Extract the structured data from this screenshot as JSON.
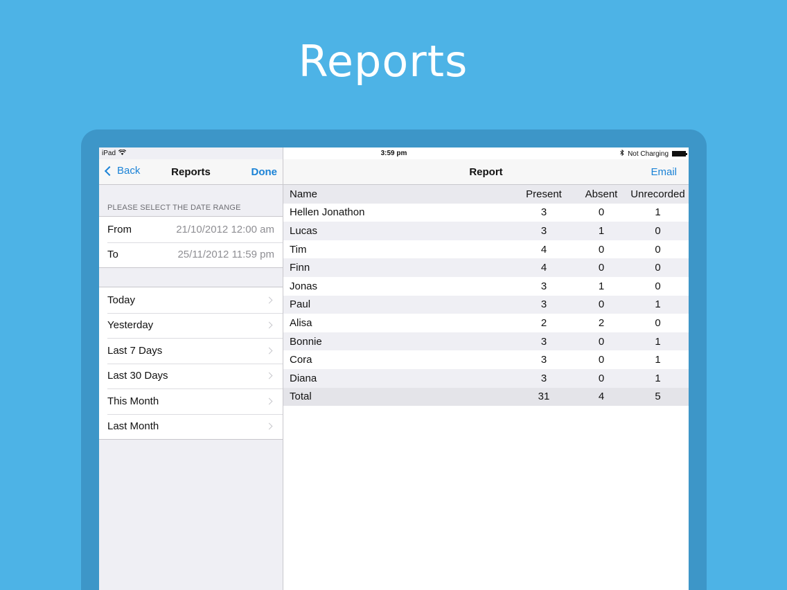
{
  "hero": {
    "title": "Reports"
  },
  "status_bar": {
    "device": "iPad",
    "time": "3:59 pm",
    "charging": "Not Charging"
  },
  "left": {
    "back_label": "Back",
    "title": "Reports",
    "done_label": "Done",
    "section_header": "PLEASE SELECT THE DATE RANGE",
    "from_label": "From",
    "from_value": "21/10/2012 12:00 am",
    "to_label": "To",
    "to_value": "25/11/2012 11:59 pm",
    "presets": [
      "Today",
      "Yesterday",
      "Last 7 Days",
      "Last 30 Days",
      "This Month",
      "Last Month"
    ]
  },
  "right": {
    "title": "Report",
    "email_label": "Email",
    "columns": [
      "Name",
      "Present",
      "Absent",
      "Unrecorded"
    ],
    "rows": [
      {
        "name": "Hellen Jonathon",
        "present": "3",
        "absent": "0",
        "unrecorded": "1"
      },
      {
        "name": "Lucas",
        "present": "3",
        "absent": "1",
        "unrecorded": "0"
      },
      {
        "name": "Tim",
        "present": "4",
        "absent": "0",
        "unrecorded": "0"
      },
      {
        "name": "Finn",
        "present": "4",
        "absent": "0",
        "unrecorded": "0"
      },
      {
        "name": "Jonas",
        "present": "3",
        "absent": "1",
        "unrecorded": "0"
      },
      {
        "name": "Paul",
        "present": "3",
        "absent": "0",
        "unrecorded": "1"
      },
      {
        "name": "Alisa",
        "present": "2",
        "absent": "2",
        "unrecorded": "0"
      },
      {
        "name": "Bonnie",
        "present": "3",
        "absent": "0",
        "unrecorded": "1"
      },
      {
        "name": "Cora",
        "present": "3",
        "absent": "0",
        "unrecorded": "1"
      },
      {
        "name": "Diana",
        "present": "3",
        "absent": "0",
        "unrecorded": "1"
      }
    ],
    "total": {
      "name": "Total",
      "present": "31",
      "absent": "4",
      "unrecorded": "5"
    }
  },
  "colors": {
    "background": "#4db3e6",
    "accent": "#1a82d6",
    "device_frame": "#3d96c8"
  }
}
